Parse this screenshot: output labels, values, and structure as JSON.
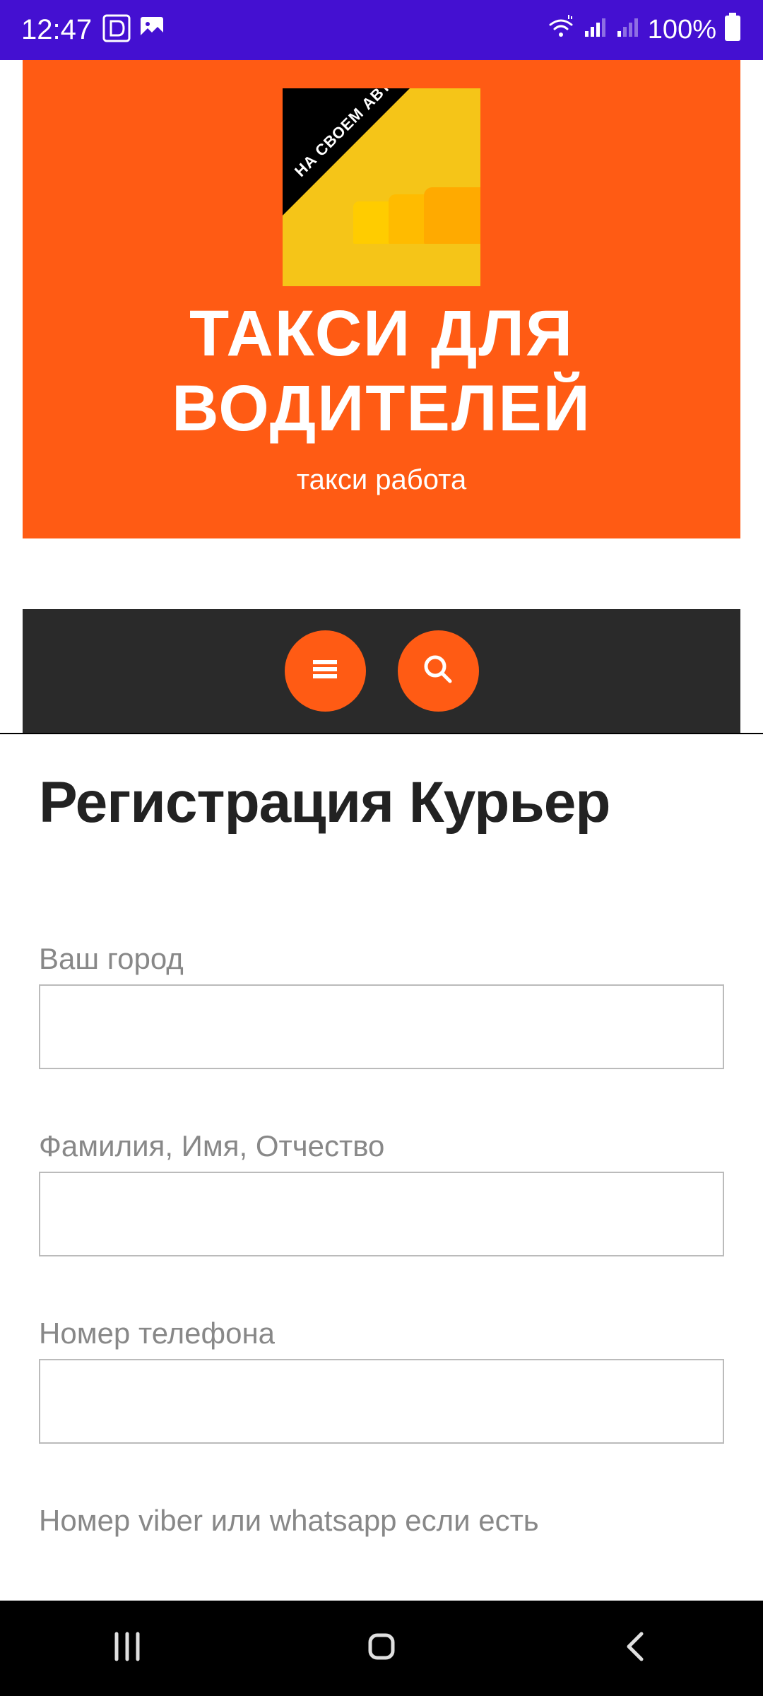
{
  "status": {
    "time": "12:47",
    "battery": "100%"
  },
  "header": {
    "logo_text": "НА СВОЕМ АВТО",
    "title": "ТАКСИ ДЛЯ ВОДИТЕЛЕЙ",
    "subtitle": "такси работа"
  },
  "page": {
    "title": "Регистрация Курьер"
  },
  "form": {
    "fields": [
      {
        "label": "Ваш город",
        "value": ""
      },
      {
        "label": "Фамилия, Имя, Отчество",
        "value": ""
      },
      {
        "label": "Номер телефона",
        "value": ""
      },
      {
        "label": "Номер viber или whatsapp если есть",
        "value": ""
      }
    ]
  }
}
